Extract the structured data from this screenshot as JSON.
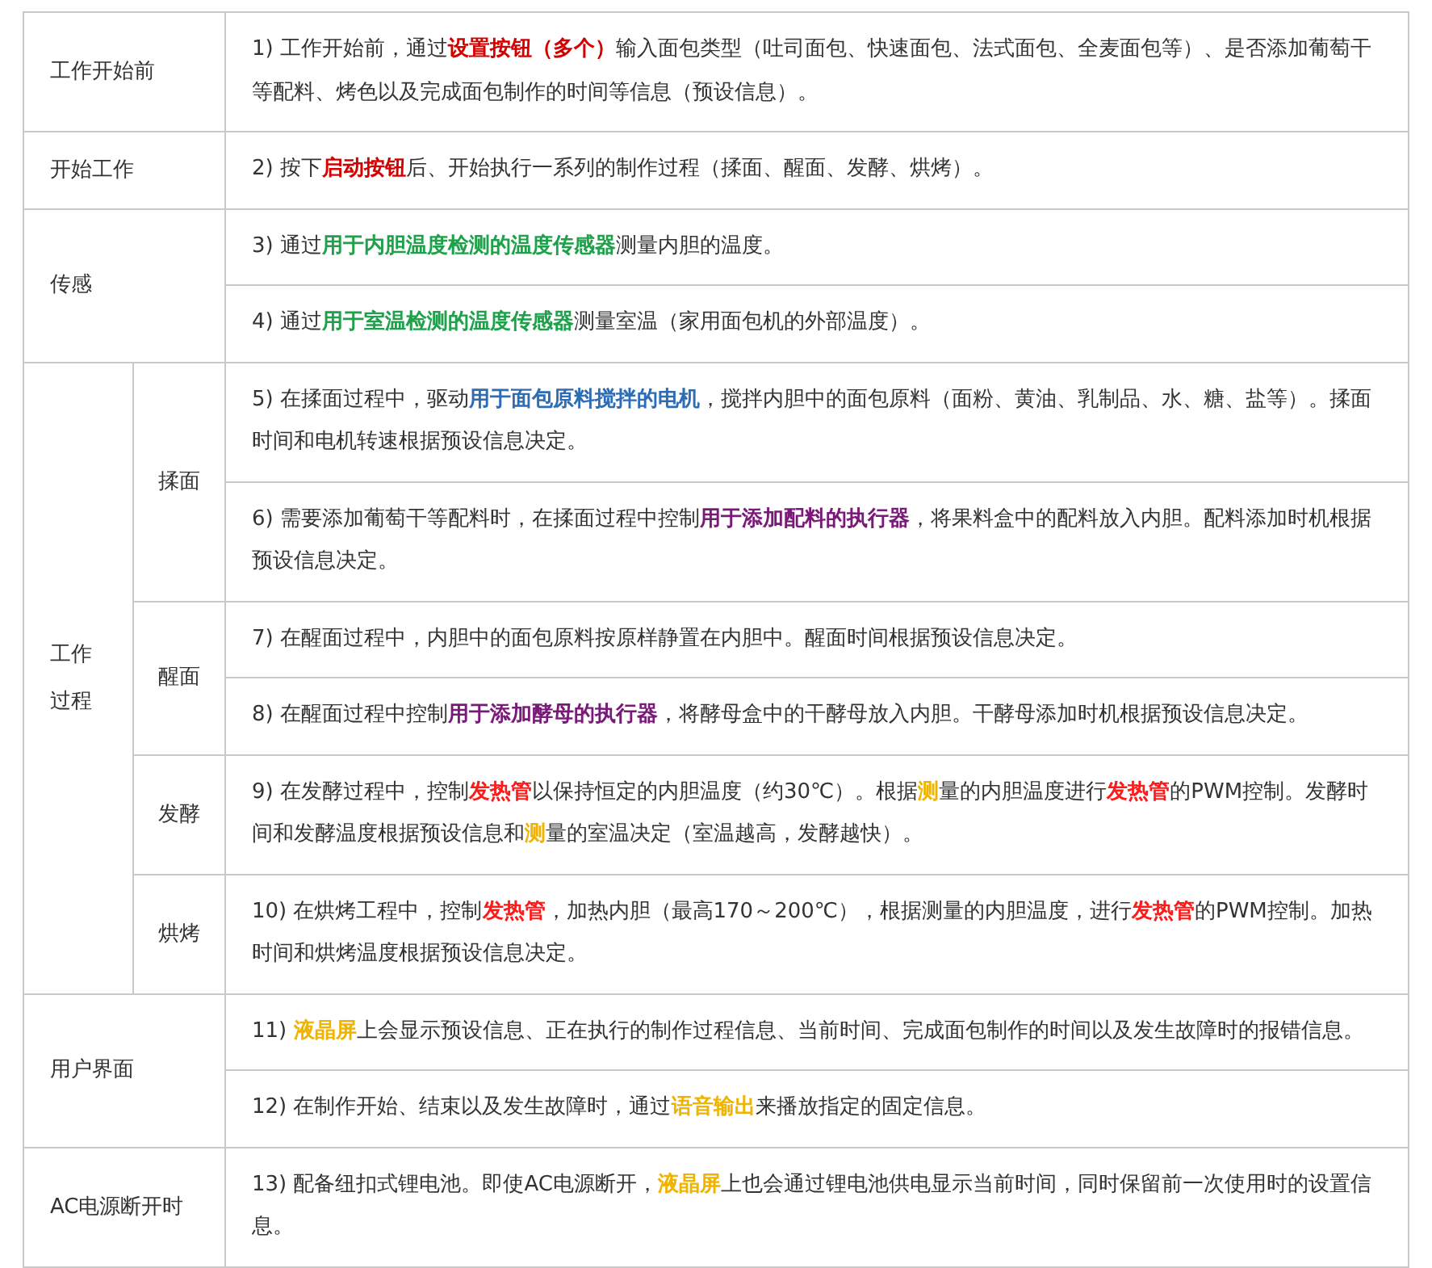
{
  "table": {
    "sections": [
      {
        "kind": "plain",
        "label": "工作开始前",
        "items": [
          [
            {
              "text": "1) 工作开始前，通过"
            },
            {
              "text": "设置按钮（多个）",
              "color": "#d40000"
            },
            {
              "text": "输入面包类型（吐司面包、快速面包、法式面包、全麦面包等）、是否添加葡萄干等配料、烤色以及完成面包制作的时间等信息（预设信息）。"
            }
          ]
        ]
      },
      {
        "kind": "plain",
        "label": "开始工作",
        "items": [
          [
            {
              "text": "2) 按下"
            },
            {
              "text": "启动按钮",
              "color": "#d40000"
            },
            {
              "text": "后、开始执行一系列的制作过程（揉面、醒面、发酵、烘烤）。"
            }
          ]
        ]
      },
      {
        "kind": "plain",
        "label": "传感",
        "items": [
          [
            {
              "text": "3) 通过"
            },
            {
              "text": "用于内胆温度检测的温度传感器",
              "color": "#1ea14a"
            },
            {
              "text": "测量内胆的温度。"
            }
          ],
          [
            {
              "text": "4) 通过"
            },
            {
              "text": "用于室温检测的温度传感器",
              "color": "#1ea14a"
            },
            {
              "text": "测量室温（家用面包机的外部温度）。"
            }
          ]
        ]
      },
      {
        "kind": "nested",
        "label": "工作过程",
        "subsections": [
          {
            "label": "揉面",
            "items": [
              [
                {
                  "text": "5) 在揉面过程中，驱动"
                },
                {
                  "text": "用于面包原料搅拌的电机",
                  "color": "#2e6db4"
                },
                {
                  "text": "，搅拌内胆中的面包原料（面粉、黄油、乳制品、水、糖、盐等）。揉面时间和电机转速根据预设信息决定。"
                }
              ],
              [
                {
                  "text": "6) 需要添加葡萄干等配料时，在揉面过程中控制"
                },
                {
                  "text": "用于添加配料的执行器",
                  "color": "#7a1a78"
                },
                {
                  "text": "，将果料盒中的配料放入内胆。配料添加时机根据预设信息决定。"
                }
              ]
            ]
          },
          {
            "label": "醒面",
            "items": [
              [
                {
                  "text": "7) 在醒面过程中，内胆中的面包原料按原样静置在内胆中。醒面时间根据预设信息决定。"
                }
              ],
              [
                {
                  "text": "8) 在醒面过程中控制"
                },
                {
                  "text": "用于添加酵母的执行器",
                  "color": "#7a1a78"
                },
                {
                  "text": "，将酵母盒中的干酵母放入内胆。干酵母添加时机根据预设信息决定。"
                }
              ]
            ]
          },
          {
            "label": "发酵",
            "items": [
              [
                {
                  "text": "9) 在发酵过程中，控制"
                },
                {
                  "text": "发热管",
                  "color": "#ff1a1a"
                },
                {
                  "text": "以保持恒定的内胆温度（约30℃）。根据"
                },
                {
                  "text": "测",
                  "color": "#f0b400"
                },
                {
                  "text": "量的内胆温度进行"
                },
                {
                  "text": "发热管",
                  "color": "#ff1a1a"
                },
                {
                  "text": "的PWM控制。发酵时间和发酵温度根据预设信息和"
                },
                {
                  "text": "测",
                  "color": "#f0b400"
                },
                {
                  "text": "量的室温决定（室温越高，发酵越快）。"
                }
              ]
            ]
          },
          {
            "label": "烘烤",
            "items": [
              [
                {
                  "text": "10) 在烘烤工程中，控制"
                },
                {
                  "text": "发热管",
                  "color": "#ff1a1a"
                },
                {
                  "text": "，加热内胆（最高170～200℃），根据测量的内胆温度，进行"
                },
                {
                  "text": "发热管",
                  "color": "#ff1a1a"
                },
                {
                  "text": "的PWM控制。加热时间和烘烤温度根据预设信息决定。"
                }
              ]
            ]
          }
        ]
      },
      {
        "kind": "plain",
        "label": "用户界面",
        "items": [
          [
            {
              "text": "11) "
            },
            {
              "text": "液晶屏",
              "color": "#f0b400"
            },
            {
              "text": "上会显示预设信息、正在执行的制作过程信息、当前时间、完成面包制作的时间以及发生故障时的报错信息。"
            }
          ],
          [
            {
              "text": "12) 在制作开始、结束以及发生故障时，通过"
            },
            {
              "text": "语音输出",
              "color": "#f0b400"
            },
            {
              "text": "来播放指定的固定信息。"
            }
          ]
        ]
      },
      {
        "kind": "plain",
        "label": "AC电源断开时",
        "items": [
          [
            {
              "text": "13) 配备纽扣式锂电池。即使AC电源断开，"
            },
            {
              "text": "液晶屏",
              "color": "#f0b400"
            },
            {
              "text": "上也会通过锂电池供电显示当前时间，同时保留前一次使用时的设置信息。"
            }
          ]
        ]
      }
    ]
  }
}
